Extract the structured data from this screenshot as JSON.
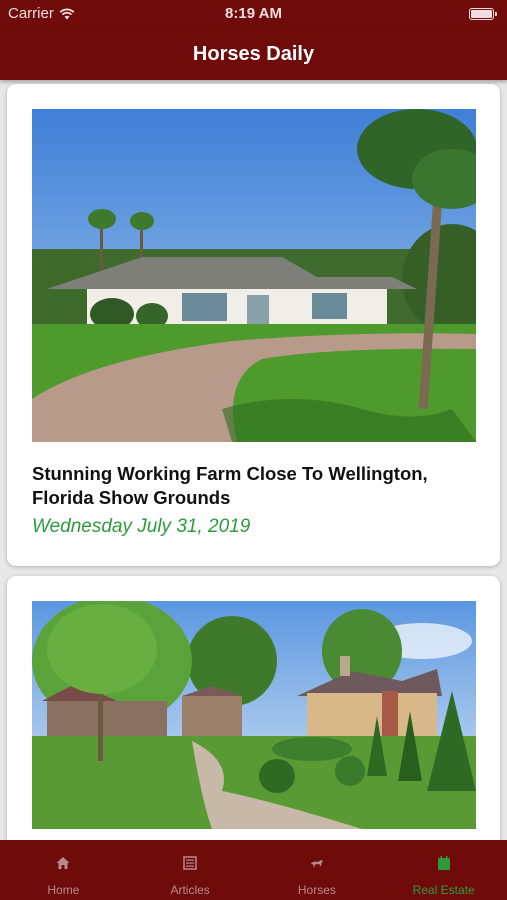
{
  "status": {
    "carrier": "Carrier",
    "time": "8:19 AM"
  },
  "header": {
    "title": "Horses Daily"
  },
  "articles": [
    {
      "title": "Stunning Working Farm Close To Wellington, Florida Show Grounds",
      "date": "Wednesday July 31, 2019"
    },
    {
      "title": "",
      "date": ""
    }
  ],
  "tabs": [
    {
      "label": "Home",
      "icon": "home-icon"
    },
    {
      "label": "Articles",
      "icon": "articles-icon"
    },
    {
      "label": "Horses",
      "icon": "horse-icon"
    },
    {
      "label": "Real Estate",
      "icon": "building-icon",
      "active": true
    }
  ],
  "colors": {
    "brand": "#6f0b0b",
    "accent_green": "#2e9a3c",
    "tab_inactive": "#b98a8a"
  }
}
